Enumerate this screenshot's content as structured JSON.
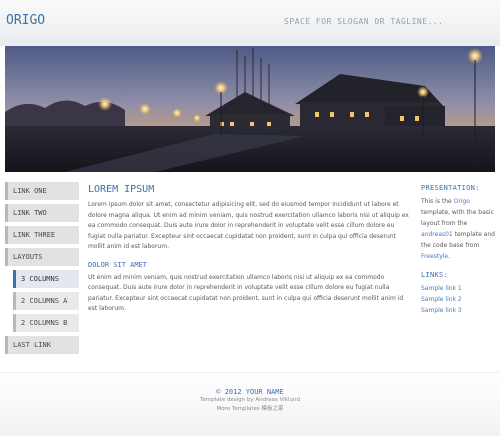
{
  "header": {
    "site_title": "ORIGO",
    "slogan": "SPACE FOR SLOGAN OR TAGLINE..."
  },
  "banner": {
    "image": "night-village-harbor-photo"
  },
  "nav": {
    "items": [
      {
        "label": "LINK ONE"
      },
      {
        "label": "LINK TWO"
      },
      {
        "label": "LINK THREE"
      },
      {
        "label": "LAYOUTS"
      },
      {
        "label": "3 COLUMNS"
      },
      {
        "label": "2 COLUMNS A"
      },
      {
        "label": "2 COLUMNS B"
      },
      {
        "label": "LAST LINK"
      }
    ]
  },
  "main": {
    "heading": "LOREM IPSUM",
    "paragraph1": "Lorem ipsum dolor sit amet, consectetur adipisicing elit, sed do eiusmod tempor incididunt ut labore et dolore magna aliqua. Ut enim ad minim veniam, quis nostrud exercitation ullamco laboris nisi ut aliquip ex ea commodo consequat. Duis aute irure dolor in reprehenderit in voluptate velit esse cillum dolore eu fugiat nulla pariatur. Excepteur sint occaecat cupidatat non proident, sunt in culpa qui officia deserunt mollit anim id est laborum.",
    "subheading": "DOLOR SIT AMET",
    "paragraph2": "Ut enim ad minim veniam, quis nostrud exercitation ullamco laboris nisi ut aliquip ex ea commodo consequat. Duis aute irure dolor in reprehenderit in voluptate velit esse cillum dolore eu fugiat nulla pariatur. Excepteur sint occaecat cupidatat non proident, sunt in culpa qui officia deserunt mollit anim id est laborum."
  },
  "aside": {
    "presentation_title": "PRESENTATION:",
    "presentation": {
      "t1": "This is the ",
      "origo_link": "Origo",
      "t2": " template, with the basic layout from the ",
      "andreas_link": "andreas01",
      "t3": " template and the code base from ",
      "freestyle_link": "Freestyle",
      "t4": "."
    },
    "links_title": "LINKS:",
    "links": [
      "Sample link 1",
      "Sample link 2",
      "Sample link 3"
    ]
  },
  "footer": {
    "copyright": "© 2012 YOUR NAME",
    "design_credit": "Template design by Andreas Viklund",
    "more_templates": "More Templates 模板之家"
  },
  "colors": {
    "accent": "#3f6fb0",
    "link": "#4a7bc0",
    "nav_bg": "#e2e2e2"
  }
}
